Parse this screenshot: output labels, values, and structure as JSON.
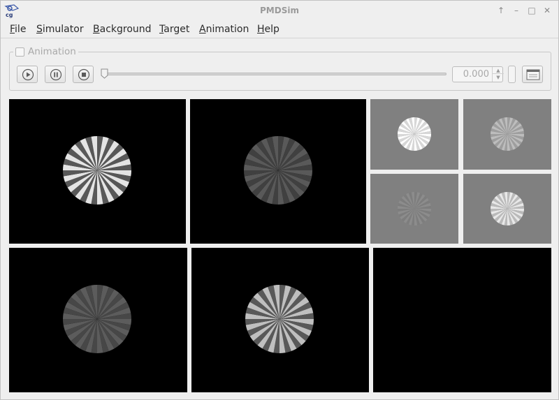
{
  "window": {
    "title": "PMDSim"
  },
  "window_buttons": [
    "↑",
    "–",
    "□",
    "✕"
  ],
  "menu": {
    "items": [
      {
        "label_u": "F",
        "label_rest": "ile"
      },
      {
        "label_u": "S",
        "label_rest": "imulator"
      },
      {
        "label_u": "B",
        "label_rest": "ackground"
      },
      {
        "label_u": "T",
        "label_rest": "arget"
      },
      {
        "label_u": "A",
        "label_rest": "nimation"
      },
      {
        "label_u": "H",
        "label_rest": "elp"
      }
    ]
  },
  "animation": {
    "group_label": "Animation",
    "enabled": false,
    "slider_position": 0.0,
    "value": "0.000",
    "buttons": [
      "play-icon",
      "pause-icon",
      "stop-icon",
      "window-icon"
    ]
  },
  "displays": [
    {
      "name": "display-1",
      "background": "#000000",
      "disk_contrast": 0.55,
      "disk_brightness": 0.62
    },
    {
      "name": "display-2",
      "background": "#000000",
      "disk_contrast": 0.1,
      "disk_brightness": 0.3
    },
    {
      "name": "thumb-1",
      "background": "#808080",
      "disk_contrast": 0.15,
      "disk_brightness": 0.92
    },
    {
      "name": "thumb-2",
      "background": "#808080",
      "disk_contrast": 0.12,
      "disk_brightness": 0.68
    },
    {
      "name": "thumb-3",
      "background": "#808080",
      "disk_contrast": 0.06,
      "disk_brightness": 0.52
    },
    {
      "name": "thumb-4",
      "background": "#808080",
      "disk_contrast": 0.18,
      "disk_brightness": 0.82
    },
    {
      "name": "display-3",
      "background": "#000000",
      "disk_contrast": 0.08,
      "disk_brightness": 0.32
    },
    {
      "name": "display-4",
      "background": "#000000",
      "disk_contrast": 0.4,
      "disk_brightness": 0.55
    },
    {
      "name": "display-5",
      "background": "#000000",
      "disk_contrast": 0,
      "disk_brightness": 0
    }
  ]
}
